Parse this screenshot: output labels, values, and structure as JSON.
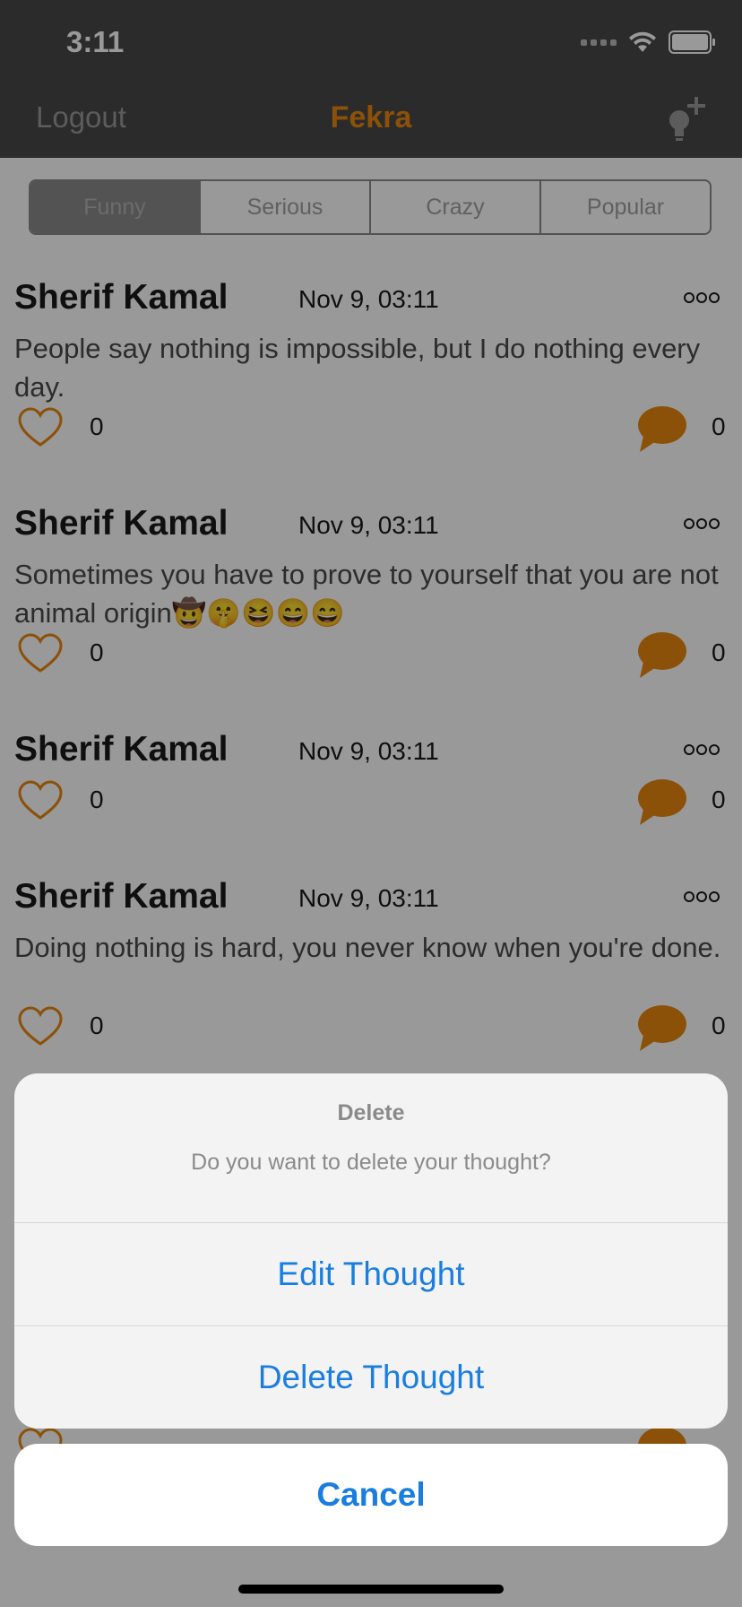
{
  "status_bar": {
    "time": "3:11"
  },
  "nav": {
    "logout_label": "Logout",
    "title": "Fekra",
    "add_icon": "lightbulb-plus-icon"
  },
  "segments": [
    "Funny",
    "Serious",
    "Crazy",
    "Popular"
  ],
  "posts": [
    {
      "author": "Sherif Kamal",
      "date": "Nov 9, 03:11",
      "text": "People say nothing is impossible, but I do nothing every day.",
      "likes": "0",
      "comments": "0"
    },
    {
      "author": "Sherif Kamal",
      "date": "Nov 9, 03:11",
      "text": "Sometimes you have to prove to yourself that you are not animal origin🤠🤫😆😄😄",
      "likes": "0",
      "comments": "0"
    },
    {
      "author": "Sherif Kamal",
      "date": "Nov 9, 03:11",
      "text": "",
      "likes": "0",
      "comments": "0"
    },
    {
      "author": "Sherif Kamal",
      "date": "Nov 9, 03:11",
      "text": "Doing nothing is hard, you never know when you're done.",
      "likes": "0",
      "comments": "0"
    }
  ],
  "action_sheet": {
    "title": "Delete",
    "message": "Do you want to delete your thought?",
    "edit_label": "Edit Thought",
    "delete_label": "Delete Thought",
    "cancel_label": "Cancel"
  },
  "colors": {
    "accent": "#e8880f",
    "ios_blue": "#1a7ee0",
    "nav_background": "#484848"
  }
}
